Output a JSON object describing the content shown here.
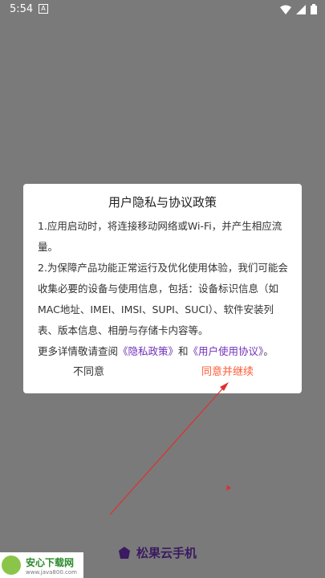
{
  "status_bar": {
    "time": "5:54",
    "badge": "A"
  },
  "dialog": {
    "title": "用户隐私与协议政策",
    "p1": "1.应用启动时，将连接移动网络或Wi-Fi，并产生相应流量。",
    "p2": "2.为保障产品功能正常运行及优化使用体验，我们可能会收集必要的设备与使用信息，包括：设备标识信息（如MAC地址、IMEI、IMSI、SUPI、SUCI）、软件安装列表、版本信息、相册与存储卡内容等。",
    "p3_prefix": "更多详情敬请查阅",
    "privacy_link": "《隐私政策》",
    "and": "和",
    "agreement_link": "《用户使用协议》",
    "p3_suffix": "。",
    "disagree_label": "不同意",
    "agree_label": "同意并继续"
  },
  "brand": {
    "name": "松果云手机"
  },
  "watermark": {
    "title": "安心下载网",
    "url": "www.java800.com"
  },
  "colors": {
    "overlay": "#7a7a7a",
    "accent": "#ff5a36",
    "link": "#6f2fb8"
  }
}
